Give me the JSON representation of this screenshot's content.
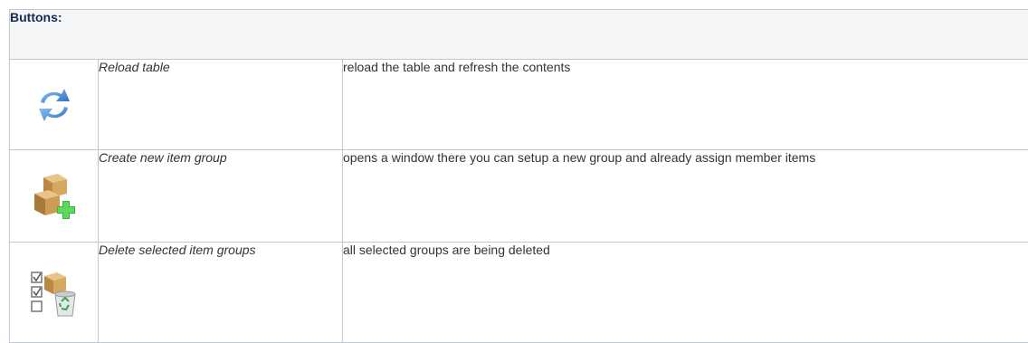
{
  "header": {
    "title": "Buttons:"
  },
  "rows": [
    {
      "icon": "reload-icon",
      "name": "Reload table",
      "description": "reload the table and refresh the contents"
    },
    {
      "icon": "create-item-group-icon",
      "name": "Create new item group",
      "description": "opens a window there you can setup a new group and already assign member items"
    },
    {
      "icon": "delete-item-groups-icon",
      "name": "Delete selected item groups",
      "description": "all selected groups are being deleted"
    }
  ],
  "colors": {
    "reload_blue": "#3a86d6",
    "box_brown": "#c79a52",
    "plus_green": "#3cc23c",
    "border": "#c1c7d0",
    "header_bg": "#f4f5f7"
  }
}
